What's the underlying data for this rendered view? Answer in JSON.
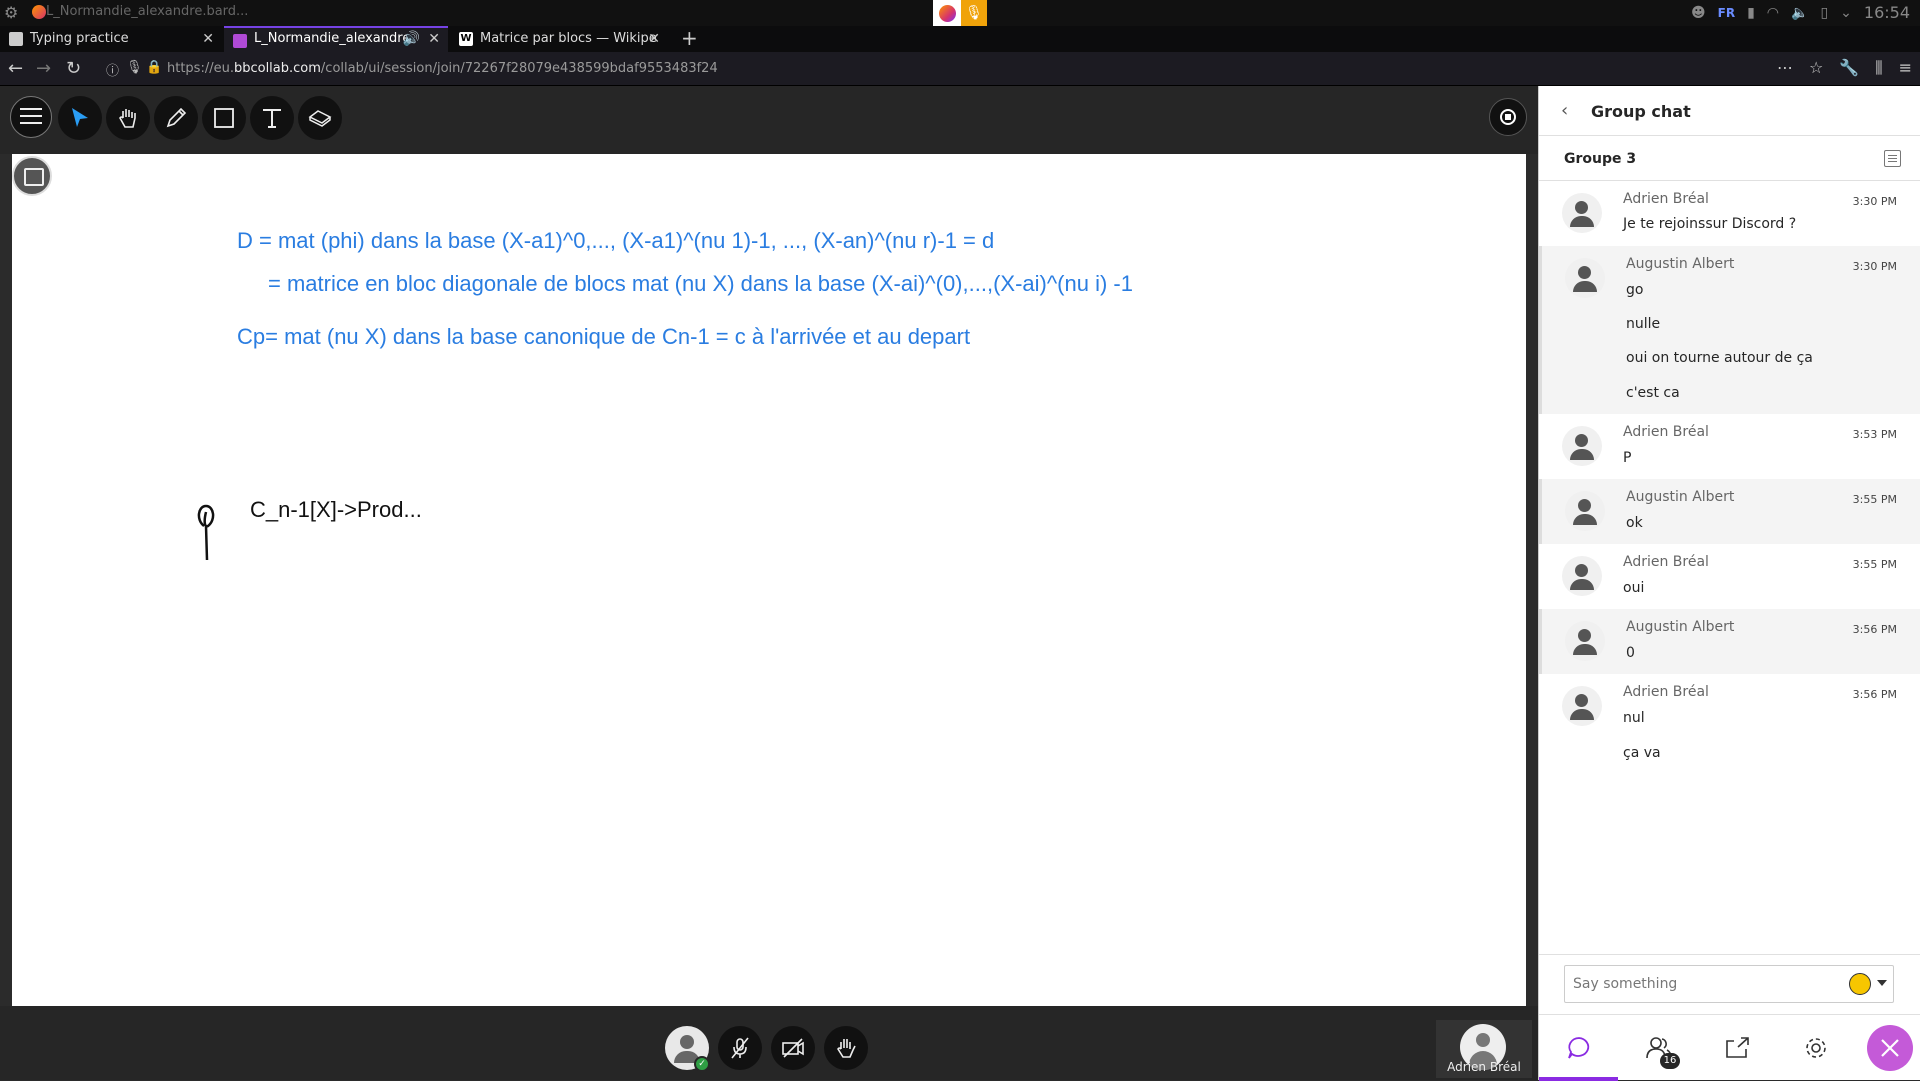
{
  "system": {
    "window_title": "L_Normandie_alexandre.bard...",
    "language": "FR",
    "time": "16:54"
  },
  "tabs": [
    {
      "label": "Typing practice"
    },
    {
      "label": "L_Normandie_alexandre"
    },
    {
      "label": "Matrice par blocs — Wikipe"
    }
  ],
  "address": {
    "url_prefix": "https://eu.",
    "url_domain": "bbcollab.com",
    "url_path": "/collab/ui/session/join/72267f28079e438599bdaf9553483f24"
  },
  "whiteboard": {
    "line1": "D = mat (phi) dans la base (X-a1)^0,..., (X-a1)^(nu 1)-1, ..., (X-an)^(nu r)-1 = d",
    "line2": "= matrice en bloc diagonale de blocs mat (nu X) dans la base (X-ai)^(0),...,(X-ai)^(nu i) -1",
    "line3": "Cp= mat (nu X) dans la base canonique de Cn-1 = c à l'arrivée et au depart",
    "line4": "C_n-1[X]->Prod..."
  },
  "self_view": {
    "name": "Adrien Bréal"
  },
  "chat": {
    "title": "Group chat",
    "group": "Groupe 3",
    "placeholder": "Say something",
    "participants_count": "16",
    "messages": [
      {
        "name": "Adrien Bréal",
        "time": "3:30 PM",
        "lines": [
          "Je te rejoinssur Discord ?"
        ]
      },
      {
        "name": "Augustin Albert",
        "time": "3:30 PM",
        "lines": [
          "go",
          "nulle",
          "oui on tourne autour de ça",
          "c'est ca"
        ]
      },
      {
        "name": "Adrien Bréal",
        "time": "3:53 PM",
        "lines": [
          "P"
        ]
      },
      {
        "name": "Augustin Albert",
        "time": "3:55 PM",
        "lines": [
          "ok"
        ]
      },
      {
        "name": "Adrien Bréal",
        "time": "3:55 PM",
        "lines": [
          "oui"
        ]
      },
      {
        "name": "Augustin Albert",
        "time": "3:56 PM",
        "lines": [
          "0"
        ]
      },
      {
        "name": "Adrien Bréal",
        "time": "3:56 PM",
        "lines": [
          "nul",
          "ça va"
        ]
      }
    ]
  },
  "icons": {
    "toolbar": [
      "menu-icon",
      "select-pointer-icon",
      "pan-hand-icon",
      "pencil-icon",
      "shape-square-icon",
      "text-icon",
      "eraser-icon"
    ],
    "accent": "#2a7de1",
    "brand": "#8a2be2"
  }
}
